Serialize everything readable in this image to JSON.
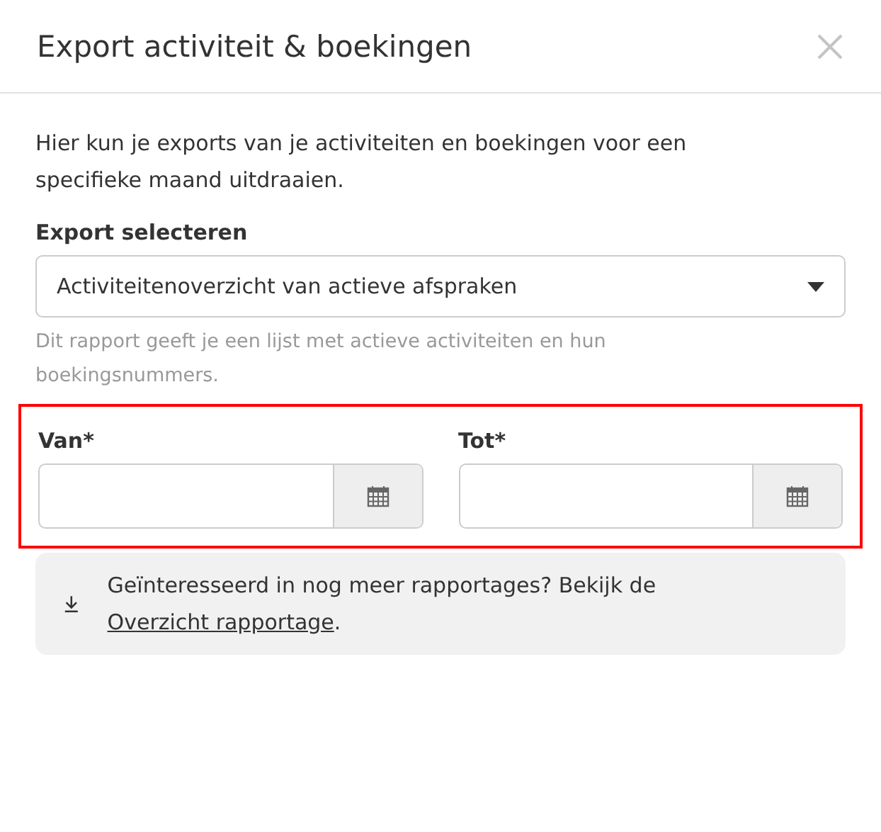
{
  "dialog": {
    "title": "Export activiteit & boekingen"
  },
  "intro": "Hier kun je exports van je activiteiten en boekingen voor een specifieke maand uitdraaien.",
  "export_select": {
    "label": "Export selecteren",
    "value": "Activiteitenoverzicht van actieve afspraken",
    "hint": "Dit rapport geeft je een lijst met actieve activiteiten en hun boekingsnummers."
  },
  "date_fields": [
    {
      "label": "Van*"
    },
    {
      "label": "Tot*"
    }
  ],
  "info": {
    "text": "Geïnteresseerd in nog meer rapportages? Bekijk de",
    "link": "Overzicht rapportage",
    "end": "."
  }
}
